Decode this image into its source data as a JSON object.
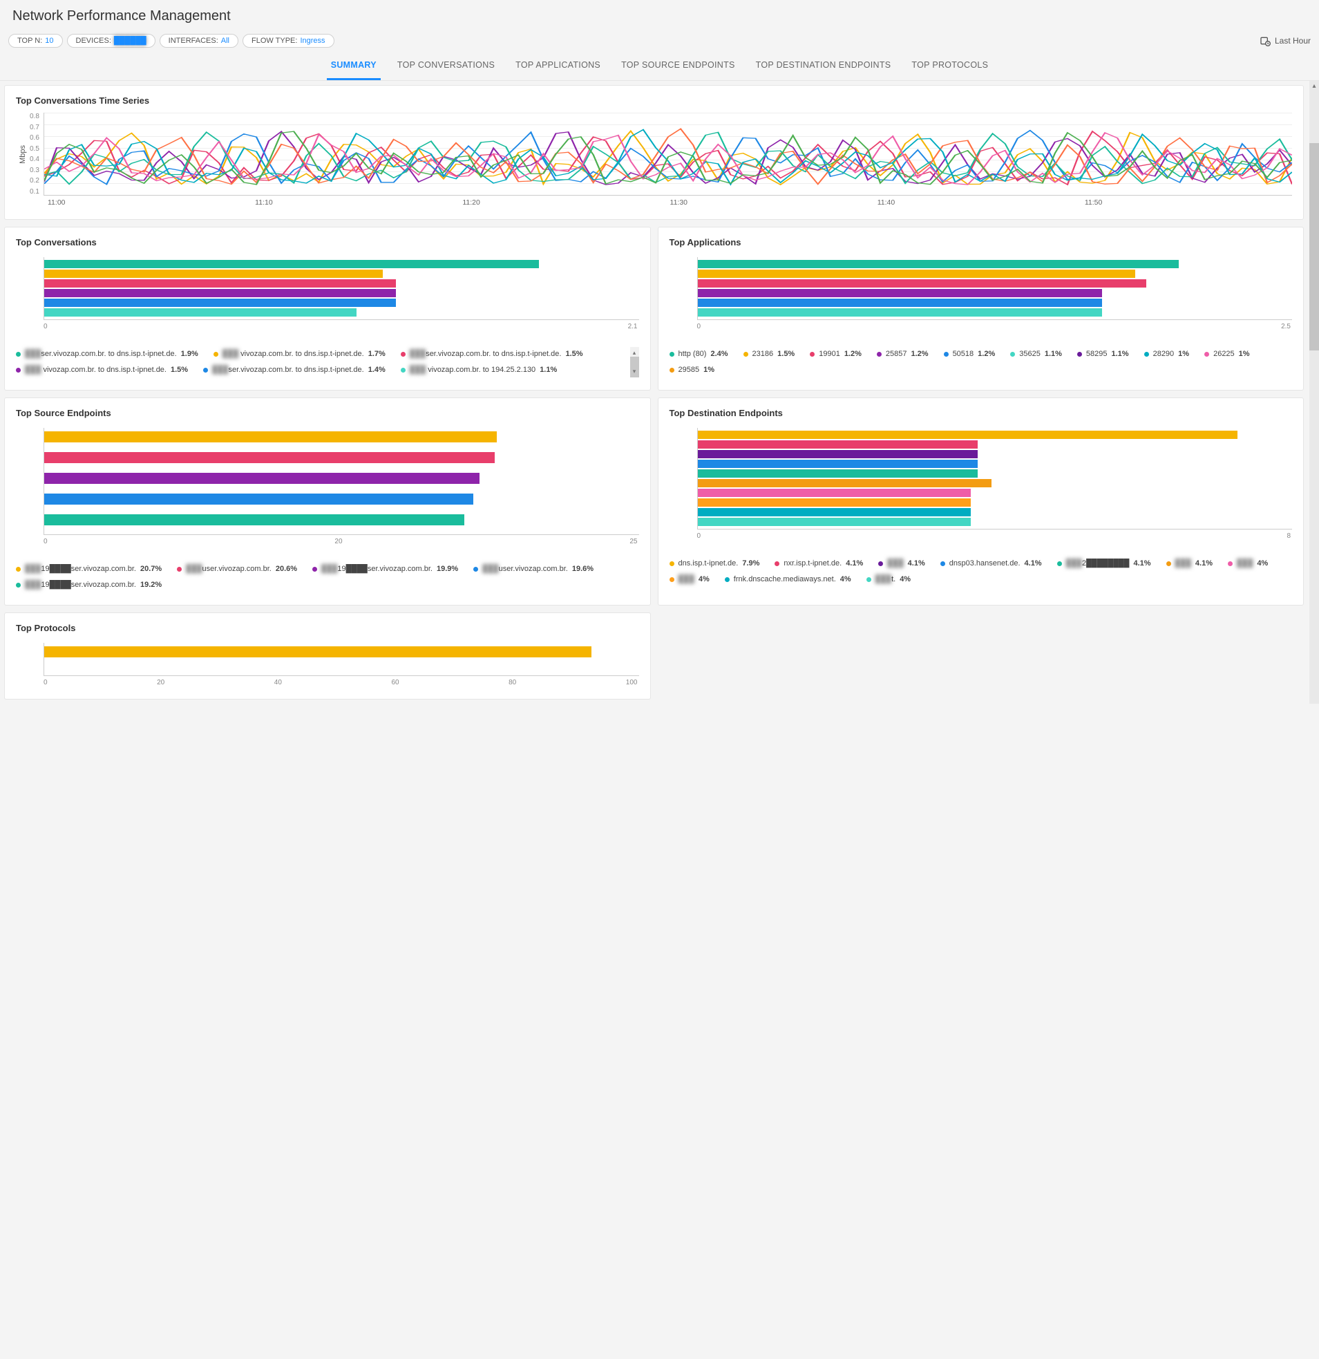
{
  "header": {
    "title": "Network Performance Management"
  },
  "filters": {
    "topn_label": "TOP N:",
    "topn_value": "10",
    "devices_label": "DEVICES:",
    "devices_value": "██████",
    "interfaces_label": "INTERFACES:",
    "interfaces_value": "All",
    "flowtype_label": "FLOW TYPE:",
    "flowtype_value": "Ingress",
    "time_range": "Last Hour"
  },
  "tabs": [
    "SUMMARY",
    "TOP CONVERSATIONS",
    "TOP APPLICATIONS",
    "TOP SOURCE ENDPOINTS",
    "TOP DESTINATION ENDPOINTS",
    "TOP PROTOCOLS"
  ],
  "active_tab": 0,
  "timeseries": {
    "title": "Top Conversations Time Series",
    "ylabel": "Mbps",
    "yticks": [
      "0.8",
      "0.7",
      "0.6",
      "0.5",
      "0.4",
      "0.3",
      "0.2",
      "0.1"
    ],
    "xticks": [
      "11:00",
      "11:10",
      "11:20",
      "11:30",
      "11:40",
      "11:50"
    ]
  },
  "colors": {
    "c0": "#f5b400",
    "c1": "#e83e6b",
    "c2": "#8e24aa",
    "c3": "#1e88e5",
    "c4": "#1abc9c",
    "c5": "#ff9f1a",
    "c6": "#6a1b9a",
    "c7": "#00acc1",
    "c8": "#43d6c3",
    "c9": "#ef5da8",
    "c10": "#f39c12"
  },
  "chart_data": [
    {
      "id": "top_conversations",
      "title": "Top Conversations",
      "type": "bar",
      "orientation": "horizontal",
      "xlim": [
        0,
        2.1
      ],
      "xticks": [
        "0",
        "2.1"
      ],
      "series": [
        {
          "label": "████ser.vivozap.com.br. to dns.isp.t-ipnet.de.",
          "pct": "1.9%",
          "value": 1.9,
          "color": "c4",
          "blur_prefix": true
        },
        {
          "label": "████ vivozap.com.br. to dns.isp.t-ipnet.de.",
          "pct": "1.7%",
          "value": 1.3,
          "color": "c0",
          "blur_prefix": true
        },
        {
          "label": "████ser.vivozap.com.br. to dns.isp.t-ipnet.de.",
          "pct": "1.5%",
          "value": 1.35,
          "color": "c1",
          "blur_prefix": true
        },
        {
          "label": "████ vivozap.com.br. to dns.isp.t-ipnet.de.",
          "pct": "1.5%",
          "value": 1.35,
          "color": "c2",
          "blur_prefix": true
        },
        {
          "label": "████ser.vivozap.com.br. to dns.isp.t-ipnet.de.",
          "pct": "1.4%",
          "value": 1.35,
          "color": "c3",
          "blur_prefix": true
        },
        {
          "label": "████ vivozap.com.br. to 194.25.2.130",
          "pct": "1.1%",
          "value": 1.2,
          "color": "c8",
          "blur_prefix": true
        }
      ]
    },
    {
      "id": "top_applications",
      "title": "Top Applications",
      "type": "bar",
      "orientation": "horizontal",
      "xlim": [
        0,
        2.5
      ],
      "xticks": [
        "0",
        "2.5"
      ],
      "series": [
        {
          "label": "http (80)",
          "pct": "2.4%",
          "value": 2.2,
          "color": "c4"
        },
        {
          "label": "23186",
          "pct": "1.5%",
          "value": 2.0,
          "color": "c0"
        },
        {
          "label": "19901",
          "pct": "1.2%",
          "value": 2.05,
          "color": "c1"
        },
        {
          "label": "25857",
          "pct": "1.2%",
          "value": 1.85,
          "color": "c2"
        },
        {
          "label": "50518",
          "pct": "1.2%",
          "value": 1.85,
          "color": "c3"
        },
        {
          "label": "35625",
          "pct": "1.1%",
          "value": 1.85,
          "color": "c8"
        },
        {
          "label": "58295",
          "pct": "1.1%",
          "value": 0,
          "color": "c6"
        },
        {
          "label": "28290",
          "pct": "1%",
          "value": 0,
          "color": "c7"
        },
        {
          "label": "26225",
          "pct": "1%",
          "value": 0,
          "color": "c9"
        },
        {
          "label": "29585",
          "pct": "1%",
          "value": 0,
          "color": "c10"
        }
      ]
    },
    {
      "id": "top_source_endpoints",
      "title": "Top Source Endpoints",
      "type": "bar",
      "orientation": "horizontal",
      "xlim": [
        0,
        25
      ],
      "xticks": [
        "0",
        "20",
        "25"
      ],
      "series": [
        {
          "label": "19████ser.vivozap.com.br.",
          "pct": "20.7%",
          "value": 20.7,
          "color": "c0",
          "blur_prefix": true
        },
        {
          "label": "████user.vivozap.com.br.",
          "pct": "20.6%",
          "value": 20.6,
          "color": "c1",
          "blur_prefix": true
        },
        {
          "label": "19████ser.vivozap.com.br.",
          "pct": "19.9%",
          "value": 19.9,
          "color": "c2",
          "blur_prefix": true
        },
        {
          "label": "████user.vivozap.com.br.",
          "pct": "19.6%",
          "value": 19.6,
          "color": "c3",
          "blur_prefix": true
        },
        {
          "label": "19████ser.vivozap.com.br.",
          "pct": "19.2%",
          "value": 19.2,
          "color": "c4",
          "blur_prefix": true
        }
      ]
    },
    {
      "id": "top_destination_endpoints",
      "title": "Top Destination Endpoints",
      "type": "bar",
      "orientation": "horizontal",
      "xlim": [
        0,
        8
      ],
      "xticks": [
        "0",
        "8"
      ],
      "series": [
        {
          "label": "dns.isp.t-ipnet.de.",
          "pct": "7.9%",
          "value": 7.9,
          "color": "c0"
        },
        {
          "label": "nxr.isp.t-ipnet.de.",
          "pct": "4.1%",
          "value": 4.1,
          "color": "c1"
        },
        {
          "label": "████████",
          "pct": "4.1%",
          "value": 4.1,
          "color": "c6",
          "blur_prefix": true
        },
        {
          "label": "dnsp03.hansenet.de.",
          "pct": "4.1%",
          "value": 4.1,
          "color": "c3"
        },
        {
          "label": "2████████",
          "pct": "4.1%",
          "value": 4.1,
          "color": "c4",
          "blur_prefix": true
        },
        {
          "label": "████████",
          "pct": "4.1%",
          "value": 4.3,
          "color": "c10",
          "blur_prefix": true
        },
        {
          "label": "████████",
          "pct": "4%",
          "value": 4.0,
          "color": "c9",
          "blur_prefix": true
        },
        {
          "label": "████████",
          "pct": "4%",
          "value": 4.0,
          "color": "c5",
          "blur_prefix": true
        },
        {
          "label": "frnk.dnscache.mediaways.net.",
          "pct": "4%",
          "value": 4.0,
          "color": "c7"
        },
        {
          "label": "████████t.",
          "pct": "4%",
          "value": 4.0,
          "color": "c8",
          "blur_prefix": true
        }
      ]
    },
    {
      "id": "top_protocols",
      "title": "Top Protocols",
      "type": "bar",
      "orientation": "horizontal",
      "xlim": [
        0,
        100
      ],
      "xticks": [
        "0",
        "20",
        "40",
        "60",
        "80",
        "100"
      ],
      "series": [
        {
          "label": "",
          "pct": "",
          "value": 100,
          "color": "c0"
        }
      ]
    }
  ]
}
